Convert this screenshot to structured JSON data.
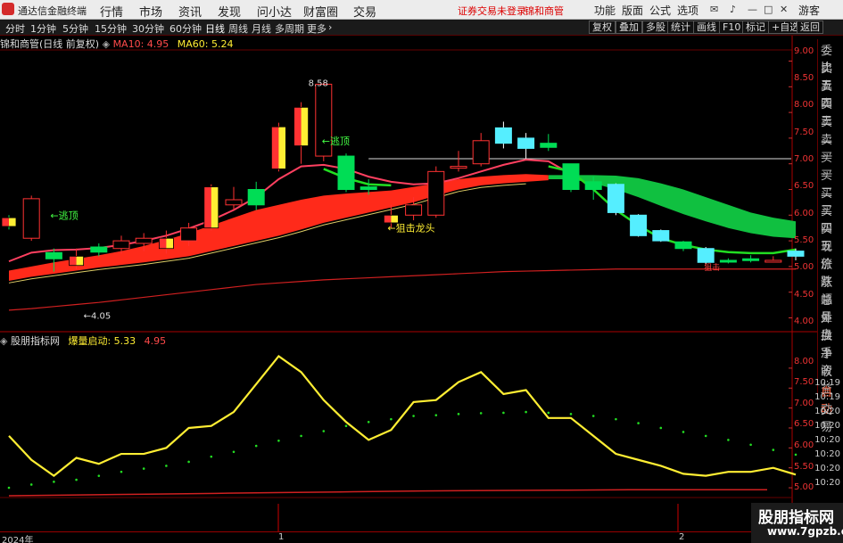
{
  "titlebar": {
    "app_name": "通达信金融终端",
    "menus": [
      "行情",
      "市场",
      "资讯",
      "发现",
      "问小达",
      "财富圈",
      "交易"
    ],
    "status": "证券交易未登录",
    "stock": "锦和商管",
    "right_menus": [
      "功能",
      "版面",
      "公式",
      "选项"
    ],
    "user": "游客"
  },
  "toolbar": {
    "periods": [
      "分时",
      "1分钟",
      "5分钟",
      "15分钟",
      "30分钟",
      "60分钟",
      "日线",
      "周线",
      "月线",
      "多周期",
      "更多"
    ],
    "active_period": "日线",
    "right_buttons": [
      "复权",
      "叠加",
      "多股",
      "统计",
      "画线",
      "F10",
      "标记",
      "+自选",
      "返回"
    ]
  },
  "main_info": {
    "name": "锦和商管(日线 前复权)",
    "ma10_label": "MA10: 4.95",
    "ma60_label": "MA60: 5.24"
  },
  "sub_info": {
    "name": "股朋指标网",
    "indicator_label": "爆量启动: 5.33",
    "value2": "4.95"
  },
  "side_panel": [
    "委比",
    "卖五",
    "卖四",
    "卖三",
    "卖二",
    "卖一",
    "买一",
    "买二",
    "买三",
    "买四",
    "买五",
    "现价",
    "涨跌",
    "涨幅",
    "总量",
    "外盘",
    "换手",
    "净资",
    "收益"
  ],
  "side_panel_sub": [
    "自动",
    "交易"
  ],
  "time_labels": [
    "10:19",
    "10:19",
    "10:20",
    "10:20",
    "10:20",
    "10:20",
    "10:20",
    "10:20"
  ],
  "main_axis": [
    "9.00",
    "8.50",
    "8.00",
    "7.50",
    "7.00",
    "6.50",
    "6.00",
    "5.50",
    "5.00",
    "4.50",
    "4.00"
  ],
  "sub_axis": [
    "8.00",
    "7.50",
    "7.00",
    "6.50",
    "6.00",
    "5.50",
    "5.00"
  ],
  "annotations": {
    "high": "8.58",
    "low": "4.05",
    "escape1": "←逃顶",
    "escape2": "←逃顶",
    "snipe": "←狙击龙头",
    "signal_small": "狙击"
  },
  "x_axis": {
    "year": "2024年",
    "m1": "1",
    "m2": "2"
  },
  "watermark": {
    "line1": "股朋指标网",
    "line2": "www.7gpzb.com"
  },
  "colors": {
    "up": "#ff3232",
    "down": "#00dd55",
    "cyan": "#55eeff",
    "yellow": "#ffee33",
    "band_red": "#ff2a1a",
    "band_green": "#10c040"
  },
  "chart_data": {
    "type": "candlestick",
    "price_range": [
      3.8,
      9.2
    ],
    "candles": [
      [
        5.95,
        5.78,
        6.0,
        5.72
      ],
      [
        5.55,
        6.32,
        6.38,
        5.5
      ],
      [
        5.27,
        5.15,
        5.35,
        4.9
      ],
      [
        5.02,
        5.2,
        5.35,
        4.95
      ],
      [
        5.38,
        5.28,
        5.45,
        5.2
      ],
      [
        5.35,
        5.5,
        5.6,
        5.25
      ],
      [
        5.45,
        5.55,
        5.65,
        5.3
      ],
      [
        5.35,
        5.55,
        5.7,
        5.25
      ],
      [
        5.5,
        5.75,
        5.85,
        5.4
      ],
      [
        5.75,
        6.55,
        6.6,
        5.7
      ],
      [
        6.2,
        6.3,
        6.55,
        6.1
      ],
      [
        6.5,
        6.2,
        6.65,
        6.1
      ],
      [
        6.9,
        7.72,
        7.8,
        6.85
      ],
      [
        7.35,
        8.1,
        8.2,
        7.0
      ],
      [
        7.15,
        8.55,
        8.58,
        7.05
      ],
      [
        7.15,
        6.5,
        7.2,
        6.45
      ],
      [
        6.55,
        6.5,
        6.7,
        6.4
      ],
      [
        5.85,
        6.0,
        6.2,
        5.75
      ],
      [
        6.0,
        6.2,
        6.35,
        5.9
      ],
      [
        6.0,
        6.85,
        6.95,
        5.95
      ],
      [
        6.95,
        6.95,
        7.25,
        6.85
      ],
      [
        7.0,
        7.45,
        7.6,
        6.95
      ],
      [
        7.4,
        7.7,
        7.82,
        7.3
      ],
      [
        7.5,
        7.3,
        7.6,
        7.1
      ],
      [
        7.4,
        7.32,
        7.58,
        7.25
      ],
      [
        7.0,
        6.5,
        7.0,
        6.45
      ],
      [
        6.65,
        6.5,
        6.75,
        6.3
      ],
      [
        6.6,
        6.05,
        6.62,
        6.0
      ],
      [
        6.0,
        5.6,
        6.02,
        5.58
      ],
      [
        5.7,
        5.5,
        5.72,
        5.48
      ],
      [
        5.48,
        5.35,
        5.5,
        5.3
      ],
      [
        5.35,
        5.08,
        5.38,
        5.05
      ],
      [
        5.12,
        5.1,
        5.16,
        5.06
      ],
      [
        5.15,
        5.12,
        5.22,
        5.08
      ],
      [
        5.12,
        5.12,
        5.2,
        5.08
      ],
      [
        5.2,
        5.3,
        5.35,
        5.12
      ]
    ],
    "ma_fast": [
      5.1,
      5.27,
      5.32,
      5.33,
      5.36,
      5.42,
      5.5,
      5.6,
      5.74,
      5.9,
      6.1,
      6.35,
      6.7,
      6.95,
      6.98,
      6.9,
      6.75,
      6.65,
      6.6,
      6.62,
      6.72,
      6.85,
      6.98,
      7.08,
      7.05,
      6.8
    ],
    "ma_green": [
      {
        "i": 14,
        "v": 6.9
      },
      {
        "i": 15,
        "v": 6.72
      },
      {
        "i": 16,
        "v": 6.6
      },
      {
        "i": 17,
        "v": 6.58
      },
      {
        "i": 24,
        "v": 6.95
      },
      {
        "i": 25,
        "v": 6.85
      },
      {
        "i": 26,
        "v": 6.5
      },
      {
        "i": 27,
        "v": 6.1
      },
      {
        "i": 28,
        "v": 5.8
      },
      {
        "i": 29,
        "v": 5.55
      },
      {
        "i": 30,
        "v": 5.42
      },
      {
        "i": 31,
        "v": 5.33
      },
      {
        "i": 32,
        "v": 5.28
      },
      {
        "i": 33,
        "v": 5.26
      },
      {
        "i": 34,
        "v": 5.26
      },
      {
        "i": 35,
        "v": 5.33
      }
    ],
    "band_top": [
      4.92,
      5.0,
      5.08,
      5.15,
      5.22,
      5.3,
      5.4,
      5.52,
      5.65,
      5.8,
      5.95,
      6.1,
      6.2,
      6.3,
      6.38,
      6.42,
      6.45,
      6.48,
      6.55,
      6.62,
      6.7,
      6.75,
      6.78,
      6.8,
      6.78,
      6.75,
      6.75,
      6.73,
      6.68,
      6.6,
      6.5,
      6.38,
      6.25,
      6.1,
      5.98,
      5.88
    ],
    "band_bot": [
      4.72,
      4.8,
      4.86,
      4.92,
      4.98,
      5.03,
      5.08,
      5.14,
      5.2,
      5.3,
      5.4,
      5.5,
      5.6,
      5.72,
      5.85,
      5.95,
      6.05,
      6.15,
      6.25,
      6.38,
      6.5,
      6.58,
      6.62,
      6.65,
      6.68,
      6.72,
      6.72,
      6.7,
      6.62,
      6.5,
      6.35,
      6.2,
      6.05,
      5.93,
      5.85,
      5.78
    ],
    "red_trend": [
      4.15,
      4.18,
      4.22,
      4.26,
      4.3,
      4.35,
      4.4,
      4.45,
      4.5,
      4.55,
      4.6,
      4.65,
      4.68,
      4.71,
      4.74,
      4.76,
      4.78,
      4.8,
      4.82,
      4.84,
      4.86,
      4.88,
      4.9,
      4.91,
      4.92,
      4.93,
      4.94,
      4.95,
      4.95,
      4.95,
      4.95,
      4.95,
      4.95,
      4.95,
      4.95,
      4.95
    ],
    "white_level": 7.1,
    "sub_range": [
      4.8,
      8.4
    ],
    "sub_yellow": [
      6.3,
      5.7,
      5.3,
      5.75,
      5.6,
      5.85,
      5.85,
      6.0,
      6.5,
      6.55,
      6.9,
      7.6,
      8.3,
      7.9,
      7.2,
      6.65,
      6.2,
      6.45,
      7.15,
      7.2,
      7.65,
      7.9,
      7.35,
      7.45,
      6.75,
      6.75,
      6.3,
      5.85,
      5.7,
      5.55,
      5.35,
      5.3,
      5.4,
      5.4,
      5.5,
      5.33
    ],
    "sub_dots": [
      5.0,
      5.08,
      5.15,
      5.2,
      5.3,
      5.4,
      5.48,
      5.55,
      5.65,
      5.78,
      5.9,
      6.05,
      6.18,
      6.3,
      6.42,
      6.55,
      6.65,
      6.72,
      6.8,
      6.82,
      6.85,
      6.87,
      6.88,
      6.9,
      6.88,
      6.85,
      6.8,
      6.72,
      6.62,
      6.5,
      6.4,
      6.3,
      6.2,
      6.08,
      5.95,
      5.83
    ],
    "sub_red_line": [
      4.8,
      4.82,
      4.84,
      4.86,
      4.88,
      4.9,
      4.92,
      4.93,
      4.94,
      4.95,
      4.95,
      4.95
    ]
  }
}
